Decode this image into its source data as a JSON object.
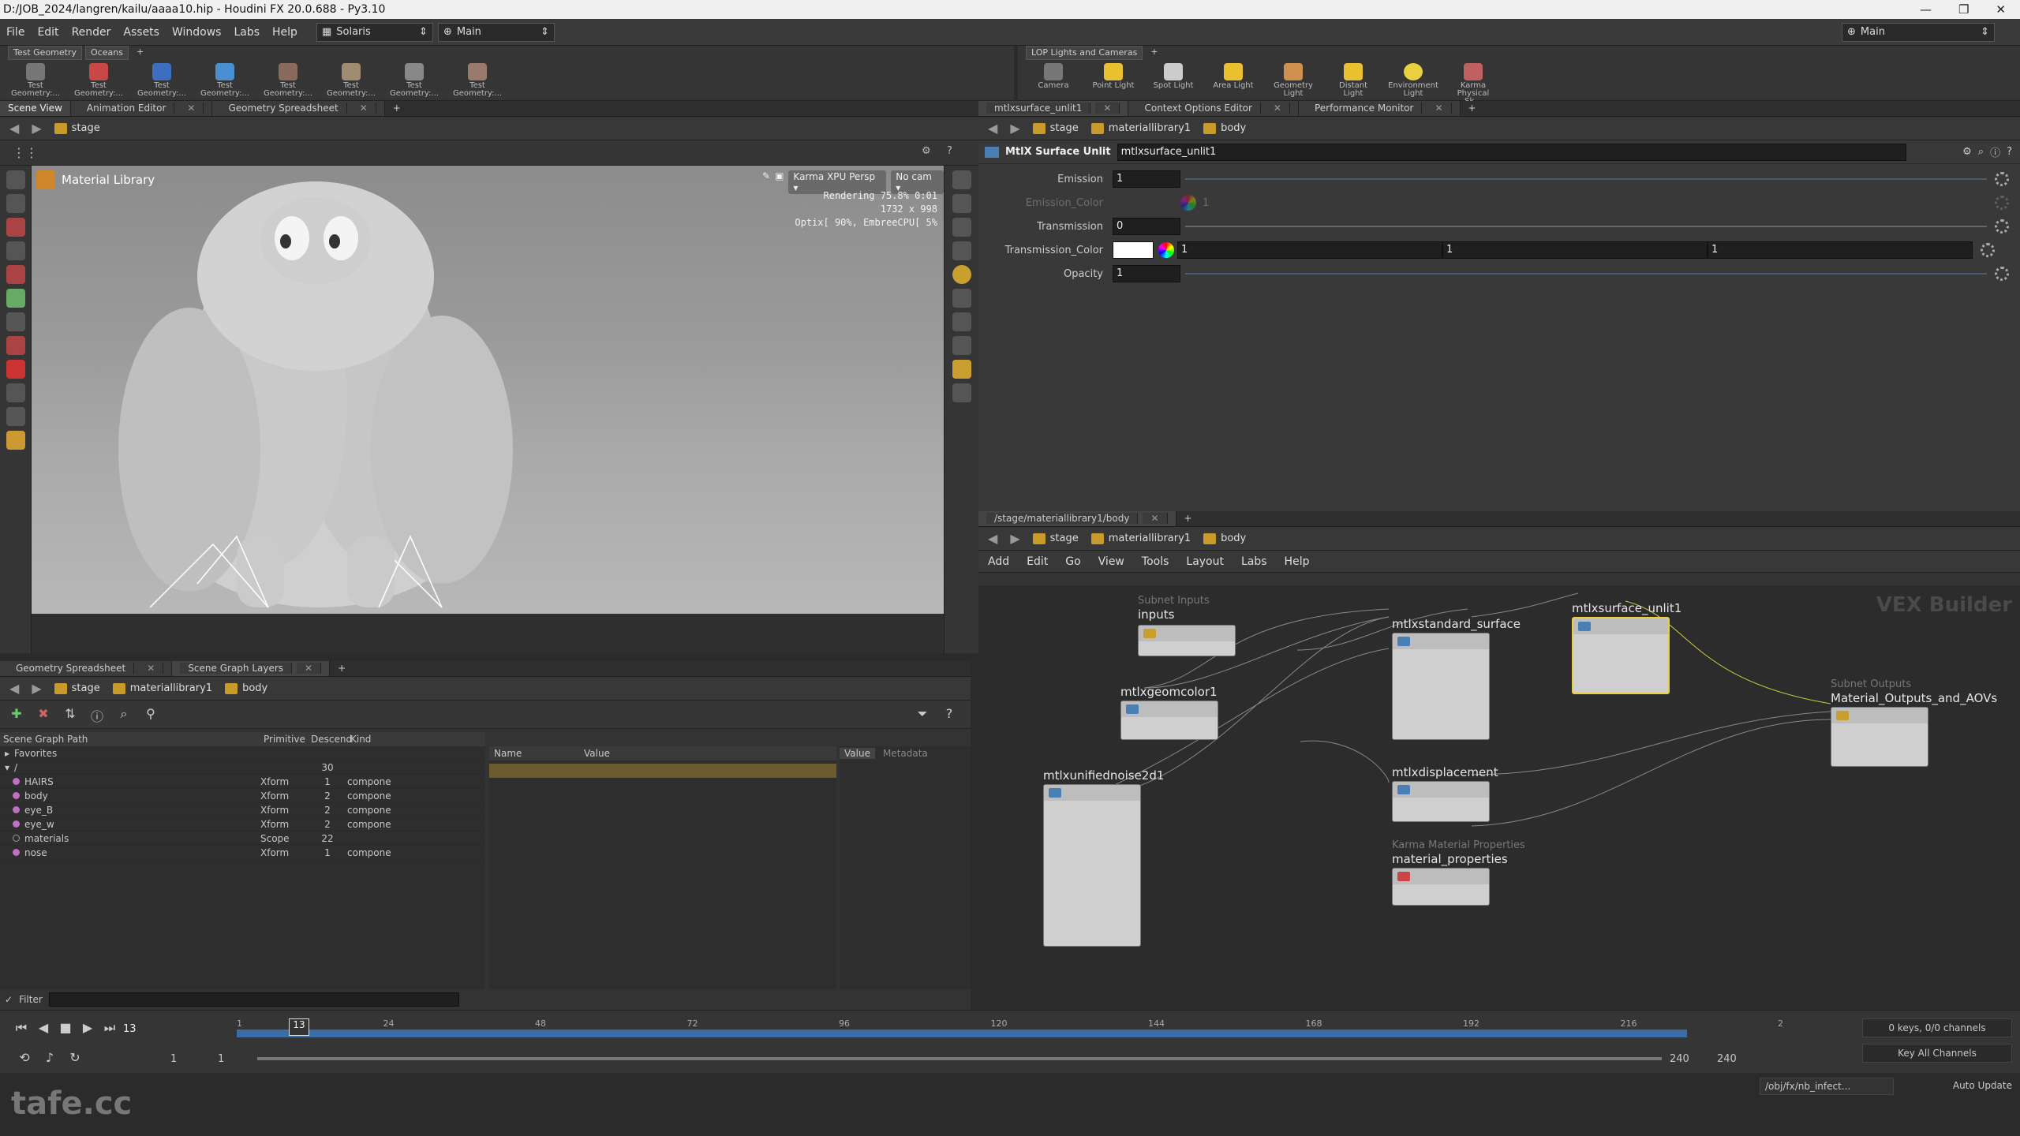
{
  "window": {
    "title": "D:/JOB_2024/langren/kailu/aaaa10.hip - Houdini FX 20.0.688 - Py3.10"
  },
  "menu": {
    "items": [
      "File",
      "Edit",
      "Render",
      "Assets",
      "Windows",
      "Labs",
      "Help"
    ],
    "desktop": "Solaris",
    "layout": "Main",
    "right_layout": "Main"
  },
  "shelf_left": {
    "tabs": [
      "Test Geometry",
      "Oceans"
    ],
    "tools": [
      "Test Geometry:...",
      "Test Geometry:...",
      "Test Geometry:...",
      "Test Geometry:...",
      "Test Geometry:...",
      "Test Geometry:...",
      "Test Geometry:...",
      "Test Geometry:..."
    ]
  },
  "shelf_right": {
    "tabs": [
      "LOP Lights and Cameras"
    ],
    "tools": [
      "Camera",
      "Point Light",
      "Spot Light",
      "Area Light",
      "Geometry Light",
      "Distant Light",
      "Environment Light",
      "Karma Physical Sk..."
    ]
  },
  "left_tabs": [
    "Scene View",
    "Animation Editor",
    "Geometry Spreadsheet"
  ],
  "right_tabs": [
    "mtlxsurface_unlit1",
    "Context Options Editor",
    "Performance Monitor"
  ],
  "path": {
    "stage": "stage",
    "lib": "materiallibrary1",
    "body": "body"
  },
  "viewport": {
    "title": "Material Library",
    "renderer": "Karma XPU",
    "camera": "Persp",
    "cam2": "No cam",
    "stats": [
      "Rendering  75.8%  0:01",
      "1732 x 998",
      "Optix[ 90%, EmbreeCPU[  5%"
    ]
  },
  "parms": {
    "node_type": "MtlX Surface Unlit",
    "node_name": "mtlxsurface_unlit1",
    "rows": [
      {
        "label": "Emission",
        "value": "1"
      },
      {
        "label": "Emission_Color",
        "value": "1"
      },
      {
        "label": "Transmission",
        "value": "0"
      },
      {
        "label": "Transmission_Color",
        "value": "1",
        "v2": "1",
        "v3": "1"
      },
      {
        "label": "Opacity",
        "value": "1"
      }
    ]
  },
  "net": {
    "tab": "/stage/materiallibrary1/body",
    "menu": [
      "Add",
      "Edit",
      "Go",
      "View",
      "Tools",
      "Layout",
      "Labs",
      "Help"
    ],
    "watermark": "VEX Builder",
    "nodes": {
      "inputs_sub": "Subnet Inputs",
      "inputs": "inputs",
      "geomcolor": "mtlxgeomcolor1",
      "noise": "mtlxunifiednoise2d1",
      "standard": "mtlxstandard_surface",
      "unlit": "mtlxsurface_unlit1",
      "displacement": "mtlxdisplacement",
      "karma_sub": "Karma Material Properties",
      "matprops": "material_properties",
      "outputs_sub": "Subnet Outputs",
      "outputs": "Material_Outputs_and_AOVs"
    }
  },
  "sg": {
    "tabs": [
      "Geometry Spreadsheet",
      "Scene Graph Layers"
    ],
    "headers": [
      "Scene Graph Path",
      "Primitive",
      "Descend",
      "Kind"
    ],
    "detail_headers": [
      "Name",
      "Value"
    ],
    "value_tabs": [
      "Value",
      "Metadata"
    ],
    "favorites": "Favorites",
    "root": {
      "name": "/",
      "desc": "30"
    },
    "rows": [
      {
        "name": "HAIRS",
        "type": "Xform",
        "desc": "1",
        "kind": "compone"
      },
      {
        "name": "body",
        "type": "Xform",
        "desc": "2",
        "kind": "compone"
      },
      {
        "name": "eye_B",
        "type": "Xform",
        "desc": "2",
        "kind": "compone"
      },
      {
        "name": "eye_w",
        "type": "Xform",
        "desc": "2",
        "kind": "compone"
      },
      {
        "name": "materials",
        "type": "Scope",
        "desc": "22",
        "kind": ""
      },
      {
        "name": "nose",
        "type": "Xform",
        "desc": "1",
        "kind": "compone"
      }
    ],
    "filter": "Filter"
  },
  "timeline": {
    "frame": "13",
    "marker": "13",
    "ticks": [
      "1",
      "24",
      "48",
      "72",
      "96",
      "120",
      "144",
      "168",
      "192",
      "216",
      "2"
    ],
    "start": "1",
    "start2": "1",
    "end": "240",
    "end2": "240",
    "keys": "0 keys, 0/0 channels",
    "keyall": "Key All Channels"
  },
  "footer": {
    "watermark": "tafe.cc",
    "path": "/obj/fx/nb_infect...",
    "update": "Auto Update"
  }
}
